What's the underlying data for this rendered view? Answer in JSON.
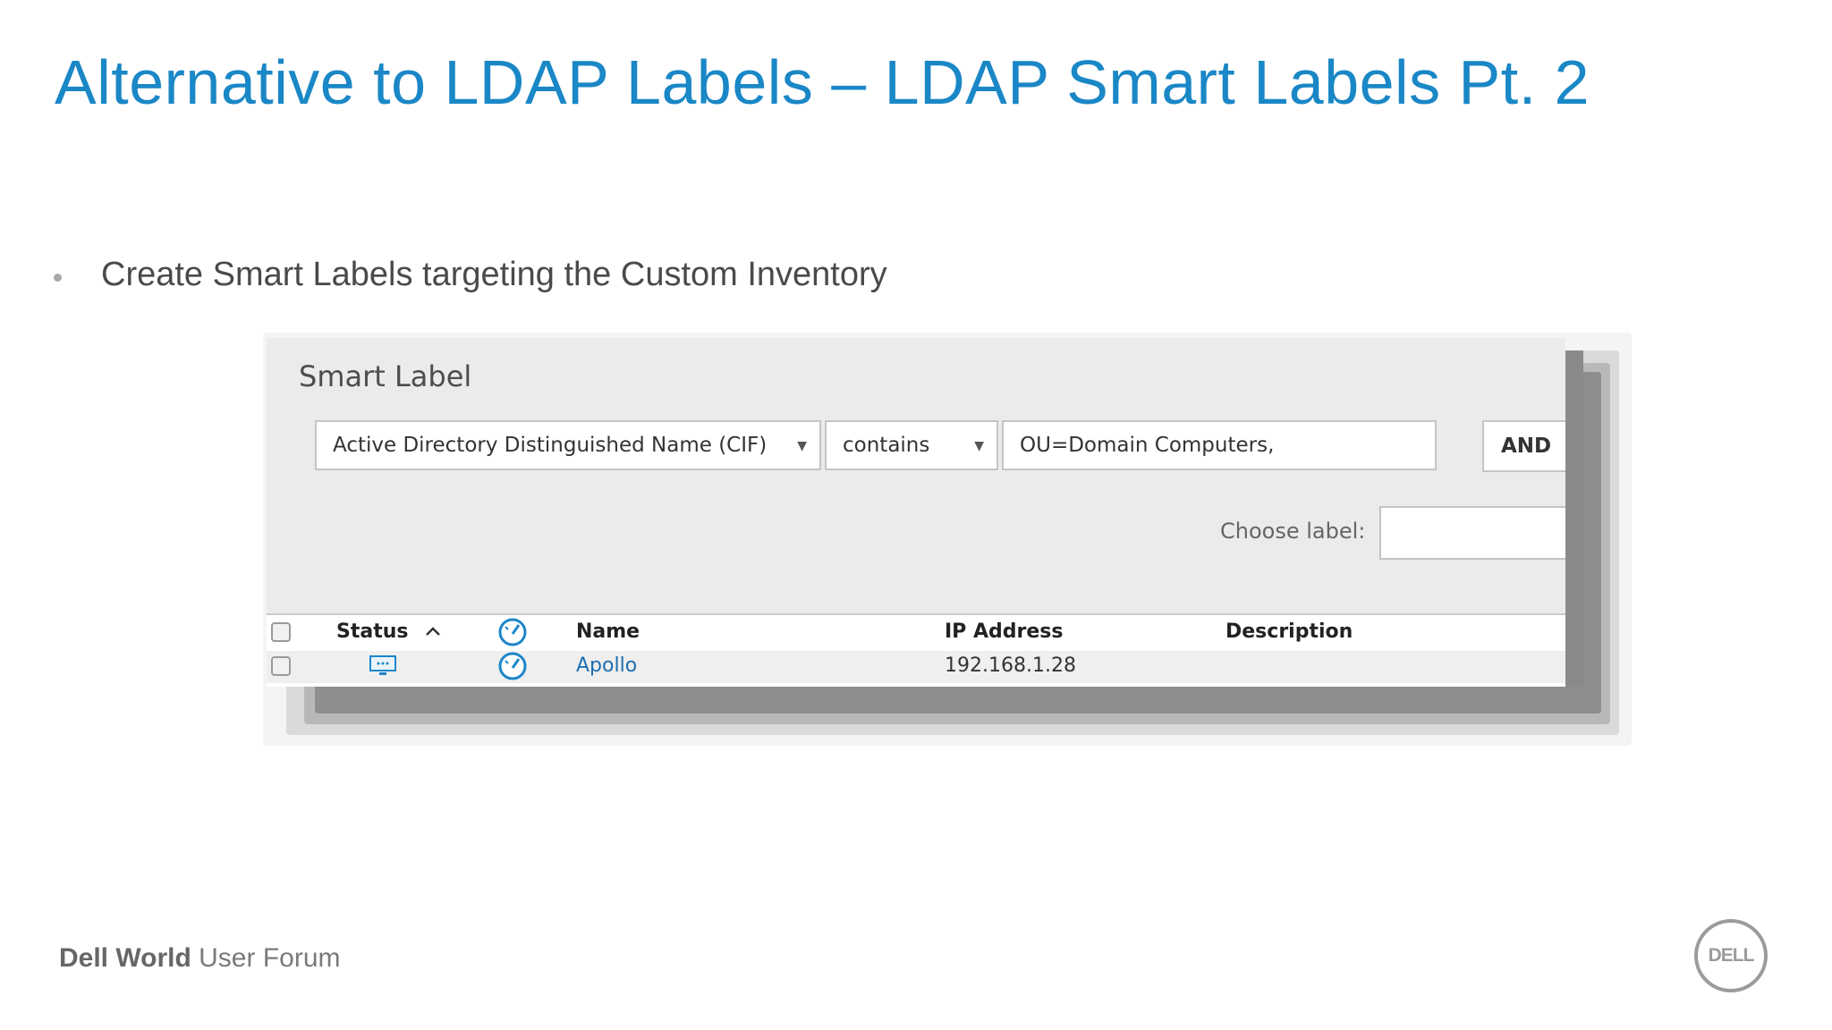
{
  "slide": {
    "title": "Alternative to LDAP Labels – LDAP Smart Labels Pt. 2",
    "bullet": "Create Smart Labels targeting the Custom Inventory"
  },
  "smart_label": {
    "panel_title": "Smart Label",
    "field_select": "Active Directory Distinguished Name (CIF)",
    "operator_select": "contains",
    "value_input": "OU=Domain Computers,",
    "and_button": "AND",
    "choose_label_text": "Choose label:",
    "choose_label_value": ""
  },
  "table": {
    "columns": [
      "Status",
      "Name",
      "IP Address",
      "Description"
    ],
    "rows": [
      {
        "status_icon": "monitor-icon",
        "name": "Apollo",
        "ip": "192.168.1.28",
        "description": ""
      }
    ]
  },
  "footer": {
    "brand_bold": "Dell World",
    "brand_light": "User Forum",
    "logo_text": "DELL"
  },
  "colors": {
    "title_blue": "#1a87c6",
    "link_blue": "#1d6fb1"
  }
}
